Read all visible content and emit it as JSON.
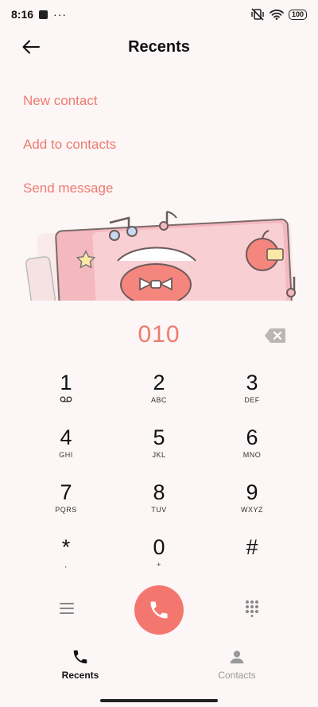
{
  "status": {
    "time": "8:16",
    "battery": "100",
    "more": "···"
  },
  "header": {
    "title": "Recents"
  },
  "actions": {
    "new_contact": "New contact",
    "add_to_contacts": "Add to contacts",
    "send_message": "Send message"
  },
  "dialer": {
    "number": "010",
    "keys": [
      {
        "digit": "1",
        "letters": ""
      },
      {
        "digit": "2",
        "letters": "ABC"
      },
      {
        "digit": "3",
        "letters": "DEF"
      },
      {
        "digit": "4",
        "letters": "GHI"
      },
      {
        "digit": "5",
        "letters": "JKL"
      },
      {
        "digit": "6",
        "letters": "MNO"
      },
      {
        "digit": "7",
        "letters": "PQRS"
      },
      {
        "digit": "8",
        "letters": "TUV"
      },
      {
        "digit": "9",
        "letters": "WXYZ"
      },
      {
        "digit": "*",
        "letters": ","
      },
      {
        "digit": "0",
        "letters": "+"
      },
      {
        "digit": "#",
        "letters": ""
      }
    ]
  },
  "nav": {
    "recents": "Recents",
    "contacts": "Contacts"
  },
  "colors": {
    "accent": "#ee7b6f",
    "call": "#f4776f",
    "background": "#fdf6f6"
  },
  "icons": {
    "back": "arrow-left-icon",
    "backspace": "backspace-icon",
    "voicemail": "voicemail-icon",
    "menu": "menu-icon",
    "call": "phone-icon",
    "dialpad": "dialpad-icon"
  }
}
